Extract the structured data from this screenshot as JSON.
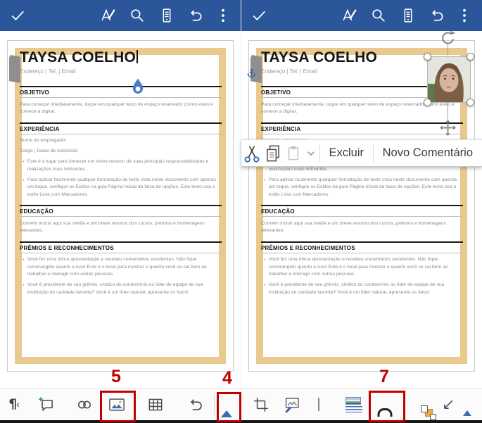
{
  "colors": {
    "toolbar_blue": "#2b579a",
    "accent_tan": "#e9c98e",
    "annotation_red": "#c00000",
    "ribbon_triangle_blue": "#3b6cb4",
    "selection_handle_gray": "#8b8b8b",
    "cursor_drop_blue": "#4b7fc4"
  },
  "top_toolbar": {
    "icons": [
      "check",
      "format-text",
      "search",
      "mobile-view",
      "undo",
      "overflow-menu"
    ]
  },
  "document": {
    "title": "TAYSA COELHO",
    "contact": "Endereço | Tel. | Email",
    "sections": [
      {
        "heading": "OBJETIVO",
        "paragraphs": [
          "Para começar imediatamente, toque em qualquer texto de espaço reservado (como este) e comece a digitar."
        ],
        "bullets": []
      },
      {
        "heading": "EXPERIÊNCIA",
        "paragraphs": [
          "Nome do empregador",
          "Cargo | Datas de Admissão"
        ],
        "bullets": [
          "Este é o lugar para fornecer um breve resumo de suas principais responsabilidades e realizações mais brilhantes.",
          "Para aplicar facilmente qualquer formatação de texto vista neste documento com apenas um toque, verifique os Estilos na guia Página Inicial da faixa de opções. Este texto usa o estilo Lista com Marcadores."
        ]
      },
      {
        "heading": "EDUCAÇÃO",
        "paragraphs": [
          "Convém incluir aqui sua média e um breve resumo dos cursos, prêmios e homenagens relevantes."
        ],
        "bullets": []
      },
      {
        "heading": "PRÊMIOS E RECONHECIMENTOS",
        "paragraphs": [],
        "bullets": [
          "Você fez uma ótima apresentação e recebeu comentários excelentes. Não fique constrangido quanto a isso! Este é o local para mostrar o quanto você se sai bem ao trabalhar e interagir com outras pessoas.",
          "Você é presidente de seu grêmio, síndico do condomínio ou líder de equipe de sua instituição de caridade favorita? Você é um líder natural, apresente os fatos!"
        ]
      }
    ]
  },
  "context_menu": {
    "icons": [
      "cut",
      "copy",
      "paste",
      "chevron-down"
    ],
    "delete_label": "Excluir",
    "new_comment_label": "Novo Comentário"
  },
  "bottom_toolbar_left": {
    "icons": [
      "formatting-marks",
      "new-comment",
      "link",
      "insert-image",
      "insert-table",
      "undo",
      "expand-ribbon"
    ]
  },
  "bottom_toolbar_right": {
    "icons": [
      "crop",
      "picture-format",
      "change-picture",
      "picture-layout",
      "wrap-text",
      "arrange",
      "resize",
      "expand-ribbon"
    ]
  },
  "annotations": {
    "step5": "5",
    "step4": "4",
    "step7": "7"
  }
}
